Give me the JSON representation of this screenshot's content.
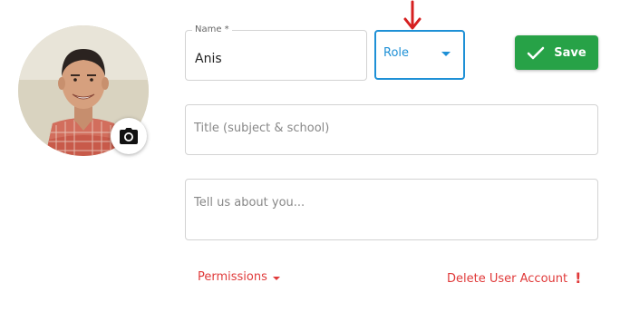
{
  "profile": {
    "name_label": "Name *",
    "name_value": "Anis",
    "role_label": "Role",
    "save_label": "Save",
    "title_placeholder": "Title (subject & school)",
    "about_placeholder": "Tell us about you...",
    "permissions_label": "Permissions",
    "delete_label": "Delete User Account"
  },
  "icons": {
    "camera": "camera-icon",
    "check": "check-icon",
    "caret": "caret-down-icon",
    "alert": "exclamation-icon",
    "arrow": "arrow-down-icon"
  },
  "colors": {
    "accent_blue": "#1e90d6",
    "save_green": "#27a247",
    "danger_red": "#e03a3a"
  }
}
